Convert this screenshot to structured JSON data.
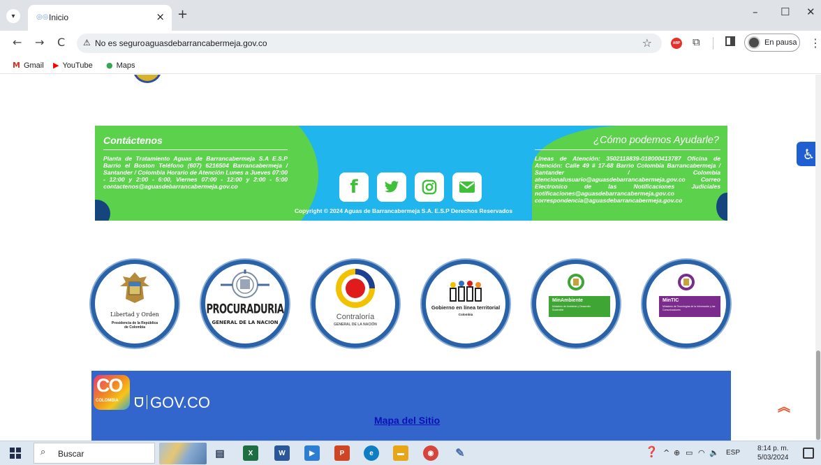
{
  "browser": {
    "tab_title": "Inicio",
    "tab_close": "×",
    "new_tab": "+",
    "window_controls": [
      "–",
      "☐",
      "✕"
    ],
    "nav": {
      "back": "←",
      "forward": "→",
      "reload": "C"
    },
    "omnibox": {
      "security_label": "No es seguro",
      "url": "aguasdebarrancabermeja.gov.co"
    },
    "abp_label": "ABP",
    "profile_label": "En pausa",
    "bookmarks": [
      {
        "label": "Gmail",
        "icon": "gmail-icon",
        "glyph": "M",
        "color": "#d93025"
      },
      {
        "label": "YouTube",
        "icon": "youtube-icon",
        "glyph": "▶",
        "color": "#ff0000"
      },
      {
        "label": "Maps",
        "icon": "maps-icon",
        "glyph": "●",
        "color": "#34a853"
      }
    ]
  },
  "footer": {
    "contact_heading": "Contáctenos",
    "contact_text": "Planta de Tratamiento Aguas de Barrancabermeja S.A E.S.P Barrio el Boston Teléfono (607) 6216504 Barrancabermeja / Santander / Colombia Horario de Atención Lunes a Jueves 07:00 - 12:00 y 2:00 - 6:00, Viernes 07:00 - 12:00 y 2:00 - 5:00 contactenos@aguasdebarrancabermeja.gov.co",
    "help_heading": "¿Cómo podemos Ayudarle?",
    "help_text": "Líneas de Atención: 3502118839-018000413787 Oficina de Atención: Calle 49 # 17-68 Barrio Colombia Barrancabermeja / Santander / Colombia atencionalusuario@aguasdebarrancabermeja.gov.co Correo Electronico de las Notificaciones Judiciales notificaciones@aguasdebarrancabermeja.gov.co correspondencia@aguasdebarrancabermeja.gov.co",
    "copyright": "Copyright © 2024 Aguas de Barrancabermeja S.A. E.S.P Derechos Reservados",
    "social": [
      {
        "name": "facebook-icon",
        "glyph": "f"
      },
      {
        "name": "twitter-icon",
        "glyph": "twitter"
      },
      {
        "name": "instagram-icon",
        "glyph": "instagram"
      },
      {
        "name": "email-icon",
        "glyph": "email"
      }
    ],
    "colors": {
      "blue": "#20b5ed",
      "green": "#5cd24c",
      "icon_green": "#3fbf3a"
    }
  },
  "entities": [
    {
      "name": "presidencia",
      "line1": "Libertad y Orden",
      "line2": "Presidencia de la República de Colombia"
    },
    {
      "name": "procuraduria",
      "line1": "PROCURADURIA",
      "line2": "GENERAL DE LA NACION"
    },
    {
      "name": "contraloria",
      "line1": "Contraloría",
      "line2": "GENERAL DE LA NACIÓN"
    },
    {
      "name": "gobierno-linea",
      "line1": "Gobierno en línea territorial",
      "line2": "Colombia"
    },
    {
      "name": "minambiente",
      "line1": "MinAmbiente",
      "line2": "Ministerio de Ambiente y Desarrollo Sostenible"
    },
    {
      "name": "mintic",
      "line1": "MinTIC",
      "line2": "Ministerio de Tecnologías de la Información y las Comunicaciones"
    }
  ],
  "gov_bar": {
    "badge_big": "CO",
    "badge_small": "COLOMBIA",
    "gov_text": "GOV.CO",
    "sitemap_link": "Mapa del Sitio",
    "color": "#3366cc"
  },
  "widgets": {
    "scroll_top": "»",
    "accessibility": "♿"
  },
  "taskbar": {
    "search_placeholder": "Buscar",
    "apps": [
      {
        "name": "task-view-icon",
        "label": "▤",
        "color": "#2b5797"
      },
      {
        "name": "excel-icon",
        "label": "X",
        "color": "#1d6f42"
      },
      {
        "name": "word-icon",
        "label": "W",
        "color": "#2b579a"
      },
      {
        "name": "media-icon",
        "label": "▶",
        "color": "#2d7dd2"
      },
      {
        "name": "powerpoint-icon",
        "label": "P",
        "color": "#d04423"
      },
      {
        "name": "edge-icon",
        "label": "e",
        "color": "#0f7dc2"
      },
      {
        "name": "file-explorer-icon",
        "label": "▬",
        "color": "#e8a515"
      },
      {
        "name": "chrome-icon",
        "label": "◉",
        "color": "#d6453c"
      },
      {
        "name": "paint-icon",
        "label": "✎",
        "color": "#4c6fa8"
      }
    ],
    "tray_lang": "ESP",
    "clock_time": "8:14 p. m.",
    "clock_date": "5/03/2024"
  }
}
